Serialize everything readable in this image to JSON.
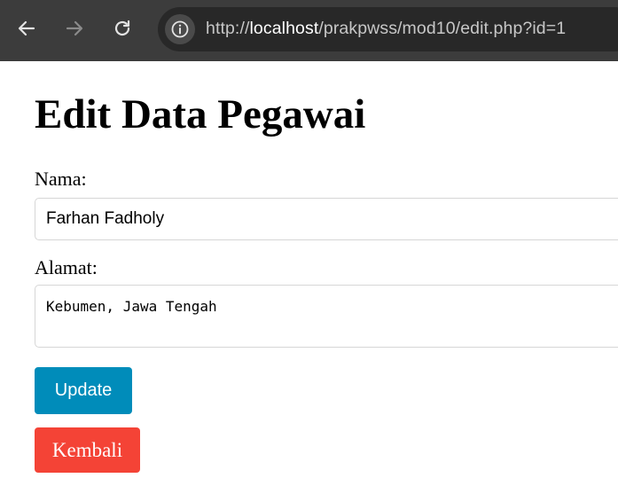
{
  "browser": {
    "url_prefix": "http://",
    "url_host": "localhost",
    "url_path": "/prakpwss/mod10/edit.php?id=1"
  },
  "page": {
    "title": "Edit Data Pegawai"
  },
  "form": {
    "nama_label": "Nama:",
    "nama_value": "Farhan Fadholy",
    "alamat_label": "Alamat:",
    "alamat_value": "Kebumen, Jawa Tengah",
    "update_label": "Update",
    "kembali_label": "Kembali"
  },
  "colors": {
    "update_button": "#008cba",
    "kembali_button": "#f44336",
    "browser_toolbar": "#3c3c3c"
  },
  "icons": {
    "back": "arrow-left-icon",
    "forward": "arrow-right-icon",
    "reload": "reload-icon",
    "site_info": "info-icon"
  }
}
